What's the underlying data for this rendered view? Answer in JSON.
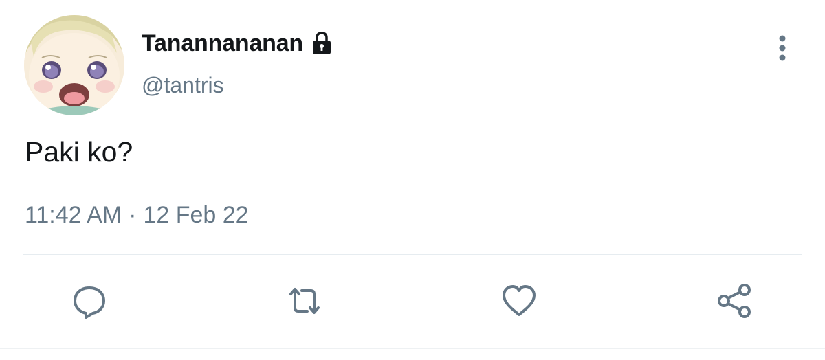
{
  "tweet": {
    "display_name": "Tanannananan",
    "handle": "@tantris",
    "text": "Paki ko?",
    "time": "11:42 AM",
    "separator": "·",
    "date": "12 Feb 22",
    "protected": true
  },
  "icons": {
    "lock": "lock-icon",
    "more": "more-vertical-icon",
    "reply": "reply-icon",
    "retweet": "retweet-icon",
    "like": "heart-icon",
    "share": "share-icon"
  },
  "colors": {
    "name": "#14171a",
    "secondary": "#657786",
    "divider": "#e6ecf0"
  }
}
